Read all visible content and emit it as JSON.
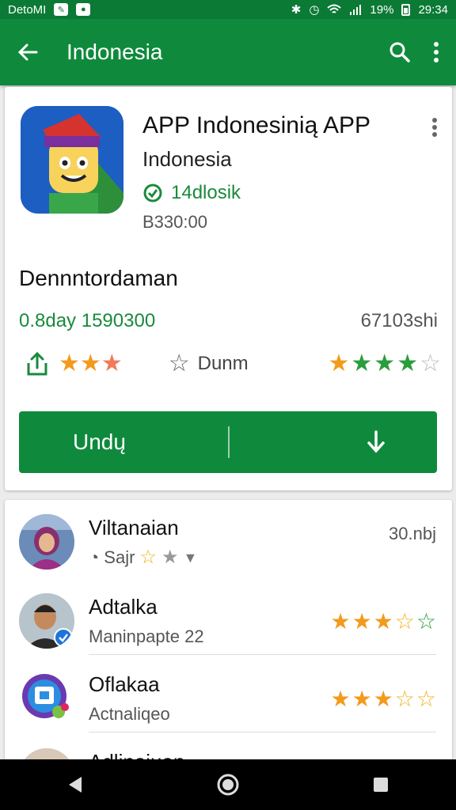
{
  "status_bar": {
    "carrier": "DetoMI",
    "battery": "19%",
    "time": "29:34"
  },
  "app_bar": {
    "title": "Indonesia"
  },
  "app": {
    "name": "APP Indonesinią APP",
    "developer": "Indonesia",
    "badge": "14dlosik",
    "size": "B330:00"
  },
  "details": {
    "section_title": "Dennntordaman",
    "downloads": "0.8day 1590300",
    "reviews_count": "67103shi",
    "rate_label": "Dunm",
    "rating_left": 2.5,
    "rating_right": 4
  },
  "install": {
    "label": "Undų"
  },
  "reviews": [
    {
      "name": "Viltanaian",
      "sub": "Sajr",
      "meta": "30.nbj",
      "rating": 1
    },
    {
      "name": "Adtalka",
      "sub": "Maninpapte 22",
      "rating": 3
    },
    {
      "name": "Oflakaa",
      "sub": "Actnaliqeo",
      "rating": 3
    },
    {
      "name": "Adlinaiuan"
    }
  ],
  "colors": {
    "primary": "#0f8a3c",
    "status_bar": "#0b7a35",
    "accent_green": "#198a3c",
    "star_orange": "#f39a1c",
    "star_green": "#2a9d3d"
  }
}
